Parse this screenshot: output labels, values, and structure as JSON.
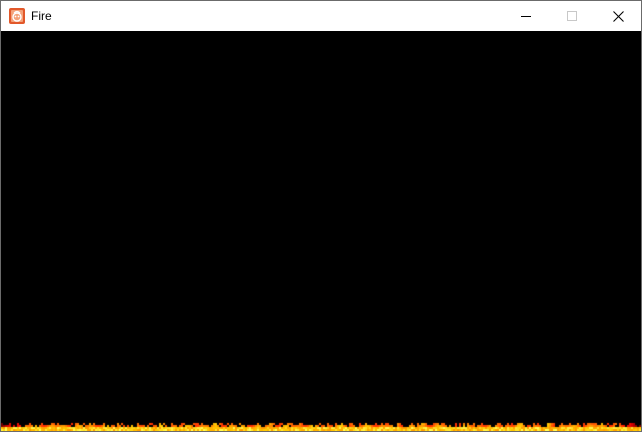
{
  "window": {
    "title": "Fire",
    "app_icon": "fire-app-icon",
    "controls": {
      "minimize_icon": "minimize-icon",
      "maximize_icon": "maximize-icon",
      "close_icon": "close-icon"
    }
  },
  "scene": {
    "background_color": "#000000",
    "flame_colors": [
      "#1a0000",
      "#5a0000",
      "#a00000",
      "#e00000",
      "#ff2000",
      "#ff5a00",
      "#ff9a00",
      "#ffd000",
      "#ffff60"
    ]
  }
}
